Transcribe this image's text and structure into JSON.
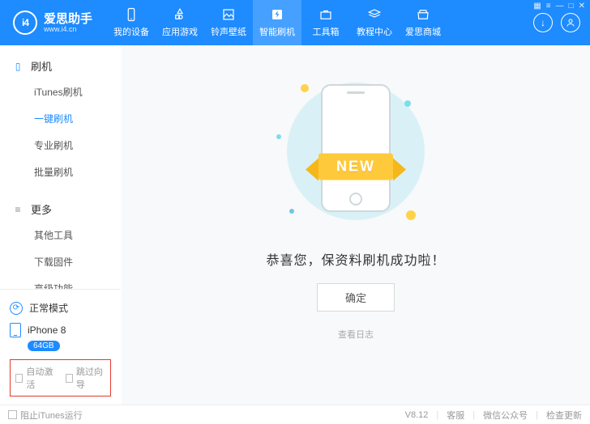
{
  "logo": {
    "mark": "i4",
    "title": "爱思助手",
    "sub": "www.i4.cn"
  },
  "nav": {
    "items": [
      {
        "label": "我的设备"
      },
      {
        "label": "应用游戏"
      },
      {
        "label": "铃声壁纸"
      },
      {
        "label": "智能刷机"
      },
      {
        "label": "工具箱"
      },
      {
        "label": "教程中心"
      },
      {
        "label": "爱思商城"
      }
    ]
  },
  "sidebar": {
    "group_flash": "刷机",
    "flash_items": [
      "iTunes刷机",
      "一键刷机",
      "专业刷机",
      "批量刷机"
    ],
    "group_more": "更多",
    "more_items": [
      "其他工具",
      "下载固件",
      "高级功能"
    ],
    "mode": "正常模式",
    "device_name": "iPhone 8",
    "storage": "64GB",
    "chk_auto": "自动激活",
    "chk_skip": "跳过向导"
  },
  "main": {
    "ribbon": "NEW",
    "result": "恭喜您，保资料刷机成功啦！",
    "ok": "确定",
    "log": "查看日志"
  },
  "footer": {
    "block_itunes": "阻止iTunes运行",
    "version": "V8.12",
    "support": "客服",
    "wechat": "微信公众号",
    "update": "检查更新"
  }
}
